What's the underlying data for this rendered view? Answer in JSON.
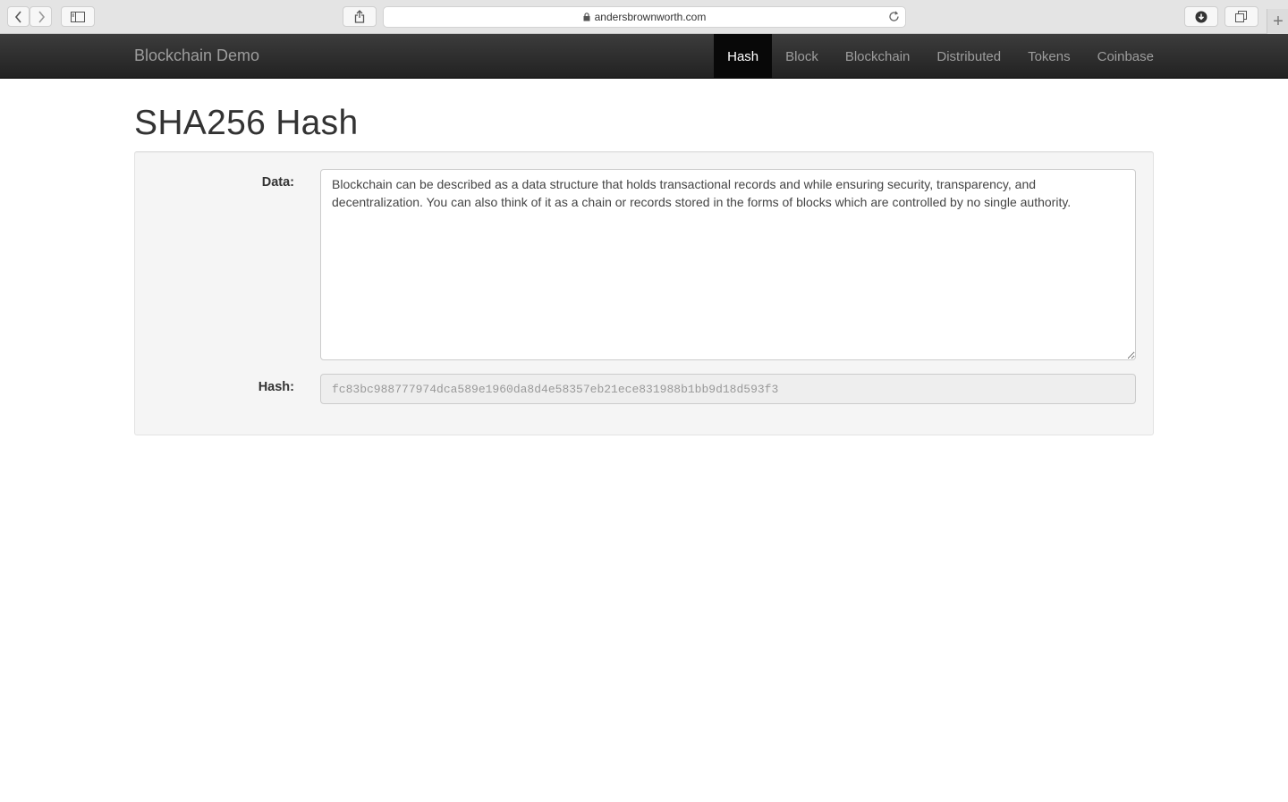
{
  "browser": {
    "url": "andersbrownworth.com"
  },
  "nav": {
    "brand": "Blockchain Demo",
    "links": [
      {
        "label": "Hash",
        "active": true
      },
      {
        "label": "Block",
        "active": false
      },
      {
        "label": "Blockchain",
        "active": false
      },
      {
        "label": "Distributed",
        "active": false
      },
      {
        "label": "Tokens",
        "active": false
      },
      {
        "label": "Coinbase",
        "active": false
      }
    ]
  },
  "page": {
    "title": "SHA256 Hash"
  },
  "form": {
    "data_label": "Data:",
    "data_value": "Blockchain can be described as a data structure that holds transactional records and while ensuring security, transparency, and decentralization. You can also think of it as a chain or records stored in the forms of blocks which are controlled by no single authority.",
    "hash_label": "Hash:",
    "hash_value": "fc83bc988777974dca589e1960da8d4e58357eb21ece831988b1bb9d18d593f3"
  }
}
